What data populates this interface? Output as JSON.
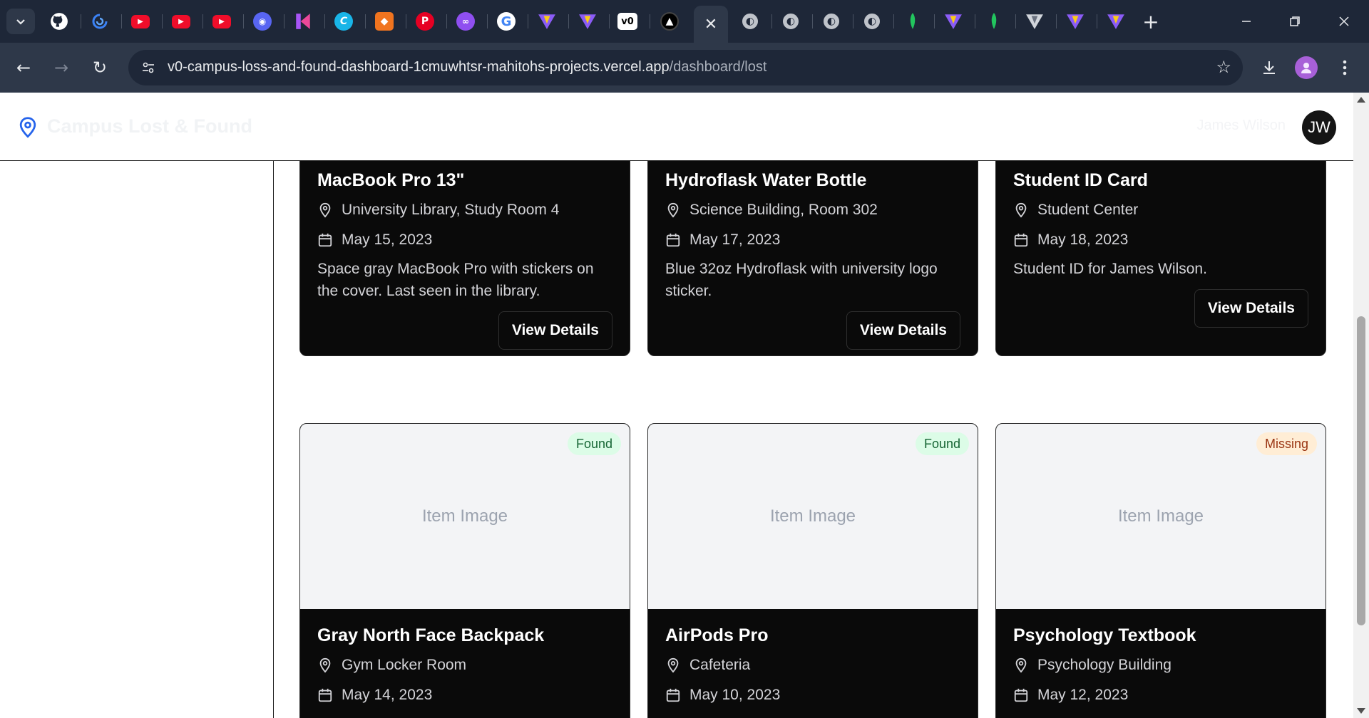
{
  "browser": {
    "url_host": "v0-campus-loss-and-found-dashboard-1cmuwhtsr-mahitohs-projects.vercel.app",
    "url_path": "/dashboard/lost",
    "tab_icons": [
      "github-icon",
      "sync-icon",
      "youtube-icon",
      "youtube-icon",
      "youtube-icon",
      "discord-icon",
      "k-logo-icon",
      "c-logo-icon",
      "box-icon",
      "pinterest-icon",
      "cloud-icon",
      "google-icon",
      "vite-icon",
      "vite-icon",
      "v0-icon",
      "triangle-icon",
      "close-tab-icon",
      "globe-icon",
      "globe-icon",
      "globe-icon",
      "globe-icon",
      "leaf-icon",
      "vite-icon",
      "leaf-icon",
      "vertex-icon",
      "vite-icon",
      "vite-icon"
    ]
  },
  "header": {
    "brand": "Campus Lost & Found",
    "username": "James Wilson",
    "avatar_initials": "JW"
  },
  "cards_top": [
    {
      "title": "MacBook Pro 13\"",
      "location": "University Library, Study Room 4",
      "date": "May 15, 2023",
      "description": "Space gray MacBook Pro with stickers on the cover. Last seen in the library.",
      "button": "View Details"
    },
    {
      "title": "Hydroflask Water Bottle",
      "location": "Science Building, Room 302",
      "date": "May 17, 2023",
      "description": "Blue 32oz Hydroflask with university logo sticker.",
      "button": "View Details"
    },
    {
      "title": "Student ID Card",
      "location": "Student Center",
      "date": "May 18, 2023",
      "description": "Student ID for James Wilson.",
      "button": "View Details"
    }
  ],
  "cards_bottom": [
    {
      "status": "Found",
      "image_placeholder": "Item Image",
      "title": "Gray North Face Backpack",
      "location": "Gym Locker Room",
      "date": "May 14, 2023"
    },
    {
      "status": "Found",
      "image_placeholder": "Item Image",
      "title": "AirPods Pro",
      "location": "Cafeteria",
      "date": "May 10, 2023"
    },
    {
      "status": "Missing",
      "image_placeholder": "Item Image",
      "title": "Psychology Textbook",
      "location": "Psychology Building",
      "date": "May 12, 2023"
    }
  ],
  "colors": {
    "accent": "#2563eb",
    "found_badge_bg": "#dcfce7",
    "missing_badge_bg": "#ffedd5",
    "card_bg": "#0a0a0a"
  }
}
